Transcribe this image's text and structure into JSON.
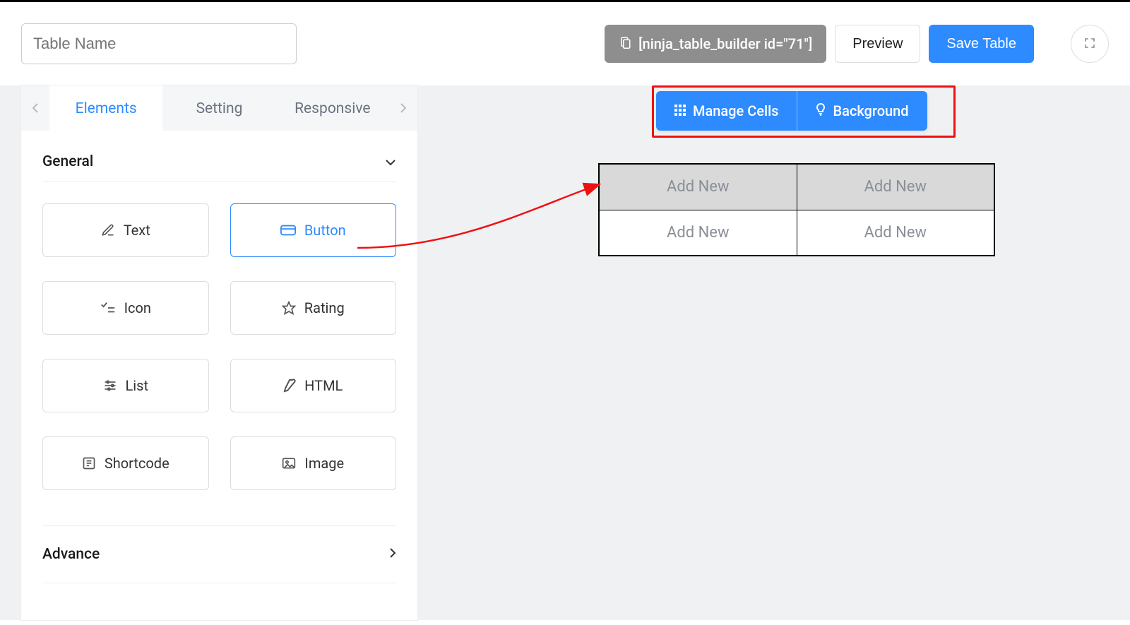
{
  "header": {
    "table_name_placeholder": "Table Name",
    "shortcode": "[ninja_table_builder id=\"71\"]",
    "preview_label": "Preview",
    "save_label": "Save Table"
  },
  "sidebar": {
    "tabs": [
      "Elements",
      "Setting",
      "Responsive"
    ],
    "active_tab_index": 0,
    "sections": {
      "general": {
        "title": "General",
        "items": [
          {
            "icon": "edit-icon",
            "label": "Text"
          },
          {
            "icon": "button-icon",
            "label": "Button",
            "active": true
          },
          {
            "icon": "check-list-icon",
            "label": "Icon"
          },
          {
            "icon": "star-icon",
            "label": "Rating"
          },
          {
            "icon": "sliders-icon",
            "label": "List"
          },
          {
            "icon": "pencil-icon",
            "label": "HTML"
          },
          {
            "icon": "shortcode-icon",
            "label": "Shortcode"
          },
          {
            "icon": "image-icon",
            "label": "Image"
          }
        ]
      },
      "advance": {
        "title": "Advance"
      }
    }
  },
  "canvas_toolbar": {
    "manage_cells_label": "Manage Cells",
    "background_label": "Background"
  },
  "table": {
    "rows": 2,
    "cols": 2,
    "cell_placeholder": "Add New"
  },
  "colors": {
    "primary": "#2e8bff",
    "annotation": "#e11",
    "chip_bg": "#8e8e8e"
  }
}
